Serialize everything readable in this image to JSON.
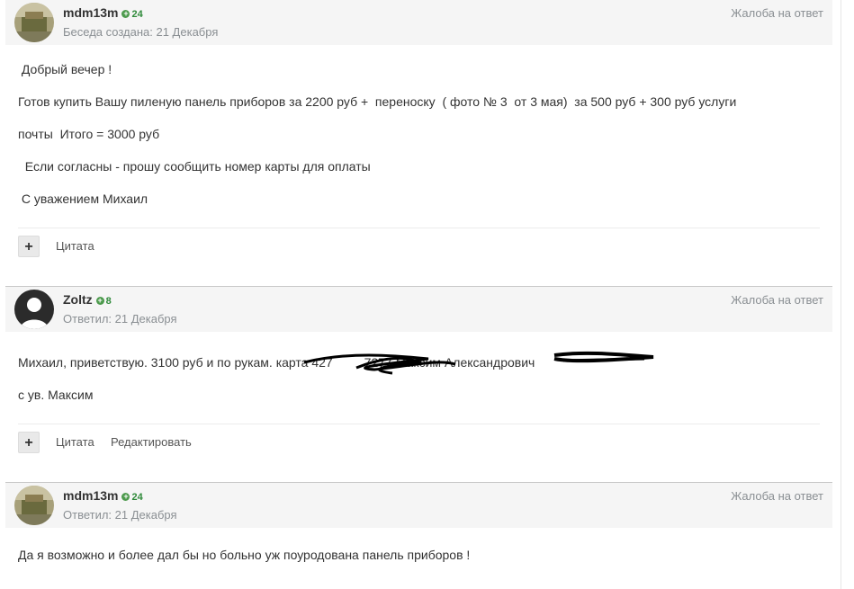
{
  "posts": [
    {
      "author": "mdm13m",
      "reputation": "24",
      "meta": "Беседа создана: 21 Декабря",
      "report": "Жалоба на ответ",
      "lines": [
        " Добрый вечер !",
        "Готов купить Вашу пиленую панель приборов за 2200 руб +  переноску  ( фото № 3  от 3 мая)  за 500 руб + 300 руб услуги",
        "почты  Итого = 3000 руб",
        "  Если согласны - прошу сообщить номер карты для оплаты",
        " С уважением Михаил"
      ],
      "plus": "+",
      "quote": "Цитата"
    },
    {
      "author": "Zoltz",
      "reputation": "8",
      "meta": "Ответил: 21 Декабря",
      "report": "Жалоба на ответ",
      "lines": [
        "Михаил, приветствую. 3100 руб и по рукам. карта 427         7277 Максим Александрович",
        "с ув. Максим"
      ],
      "plus": "+",
      "quote": "Цитата",
      "edit": "Редактировать"
    },
    {
      "author": "mdm13m",
      "reputation": "24",
      "meta": "Ответил: 21 Декабря",
      "report": "Жалоба на ответ",
      "lines": [
        "Да я возможно и более дал бы но больно уж поуродована панель приборов !"
      ]
    }
  ],
  "icons": {
    "reputation": "plus-circle-icon",
    "avatar_default": "user-silhouette-icon"
  },
  "colors": {
    "reputation": "#2f8a3a",
    "header_bg": "#f5f5f5",
    "muted": "#8a8f93"
  }
}
